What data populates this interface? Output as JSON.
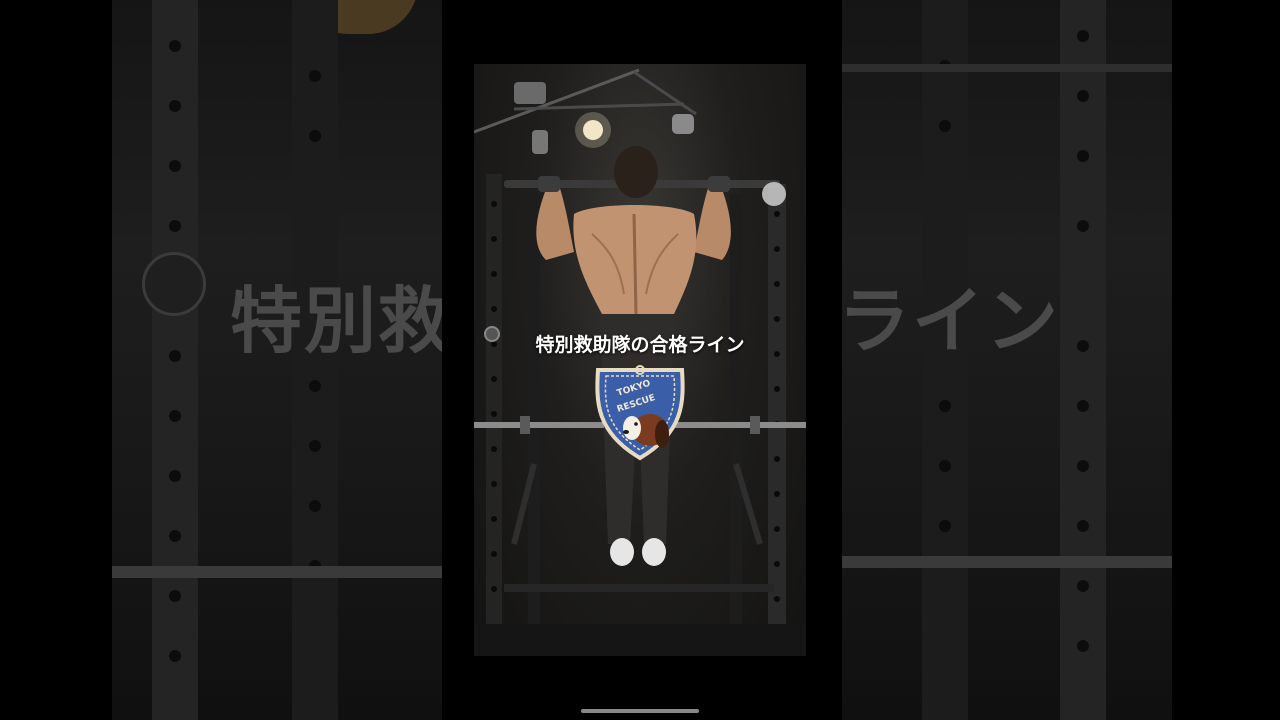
{
  "video": {
    "caption": "特別救助隊の合格ライン",
    "background_caption_left": "特別救",
    "background_caption_right": "ライン"
  },
  "badge": {
    "text_line1": "TOKYO",
    "text_line2": "RESCUE",
    "colors": {
      "field": "#3b5ea8",
      "border": "#e8dcc0",
      "dog_brown": "#7a3b1e"
    }
  },
  "colors": {
    "background": "#000000",
    "caption_text": "#ffffff",
    "home_indicator": "#8a8a8a"
  },
  "icons": [
    "home-indicator"
  ]
}
